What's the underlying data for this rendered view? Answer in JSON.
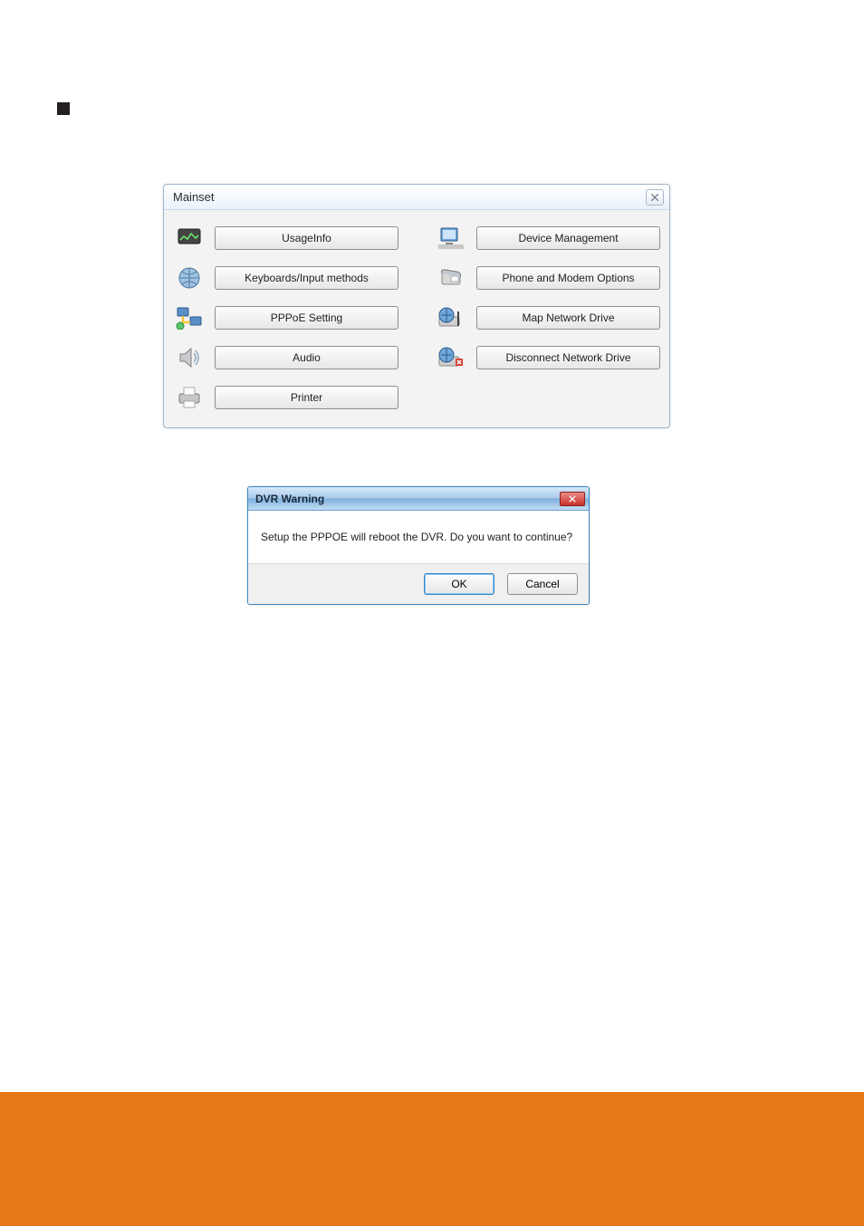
{
  "mainset": {
    "title": "Mainset",
    "buttons": {
      "usageInfo": "UsageInfo",
      "keyboards": "Keyboards/Input methods",
      "pppoe": "PPPoE Setting",
      "audio": "Audio",
      "printer": "Printer",
      "deviceMgmt": "Device Management",
      "phoneModem": "Phone and Modem Options",
      "mapDrive": "Map Network Drive",
      "disconnectDrive": "Disconnect Network Drive"
    }
  },
  "dvrWarning": {
    "title": "DVR Warning",
    "message": "Setup the PPPOE will reboot the DVR. Do you want to continue?",
    "ok": "OK",
    "cancel": "Cancel"
  }
}
